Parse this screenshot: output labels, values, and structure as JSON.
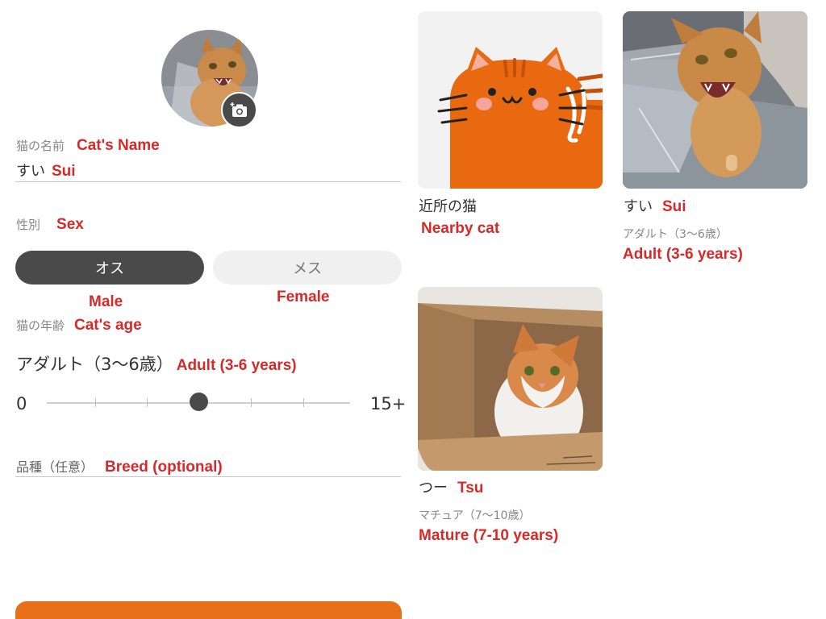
{
  "profile": {
    "avatar_alt": "cat photo",
    "edit_photo_icon": "camera-plus-icon"
  },
  "form": {
    "name_label": "猫の名前",
    "name_label_en": "Cat's Name",
    "name_value": "すい",
    "name_value_en": "Sui",
    "sex_label": "性別",
    "sex_label_en": "Sex",
    "sex_options": [
      {
        "label": "オス",
        "label_en": "Male",
        "selected": true
      },
      {
        "label": "メス",
        "label_en": "Female",
        "selected": false
      }
    ],
    "age_label": "猫の年齢",
    "age_label_en": "Cat's age",
    "age_value": "アダルト（3〜6歳）",
    "age_value_en": "Adult (3-6 years)",
    "age_slider": {
      "min_label": "0",
      "max_label": "15+",
      "level": 0.5
    },
    "breed_label": "品種（任意）",
    "breed_label_en": "Breed (optional)"
  },
  "cards": [
    {
      "title": "近所の猫",
      "title_en": "Nearby cat",
      "subtitle": "",
      "subtitle_en": ""
    },
    {
      "title": "すい",
      "title_en": "Sui",
      "subtitle": "アダルト（3〜6歳）",
      "subtitle_en": "Adult (3-6 years)"
    },
    {
      "title": "つー",
      "title_en": "Tsu",
      "subtitle": "マチュア（7〜10歳）",
      "subtitle_en": "Mature (7-10 years)"
    }
  ],
  "colors": {
    "accent": "#e8701a",
    "selected_segment": "#4a4a4a",
    "annotation": "#d52a2a",
    "illustration_cat": "#e8690f"
  }
}
